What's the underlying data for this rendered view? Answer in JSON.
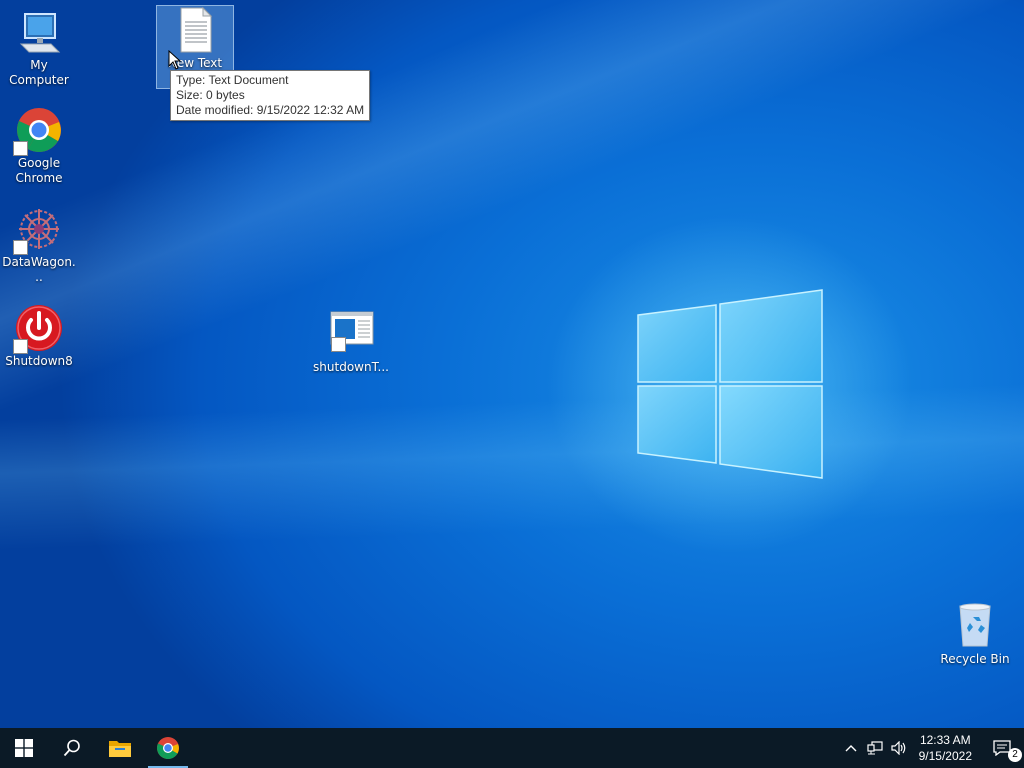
{
  "desktop": {
    "icons": {
      "my_computer": "My Computer",
      "new_text": "New Text",
      "chrome": "Google Chrome",
      "datawagon": "DataWagon...",
      "shutdown8": "Shutdown8",
      "shutdownt": "shutdownT...",
      "recycle_bin": "Recycle Bin"
    },
    "tooltip": {
      "type": "Type: Text Document",
      "size": "Size: 0 bytes",
      "modified": "Date modified: 9/15/2022 12:32 AM"
    }
  },
  "taskbar": {
    "start_icon": "windows-start-icon",
    "search_icon": "search-icon",
    "pinned": [
      "file-explorer-icon",
      "chrome-icon"
    ],
    "tray": {
      "time": "12:33 AM",
      "date": "9/15/2022",
      "notification_count": "2"
    }
  },
  "colors": {
    "taskbar": "#0b1a26",
    "desktop_blue": "#0a6fd6",
    "accent": "#76b9ed"
  }
}
